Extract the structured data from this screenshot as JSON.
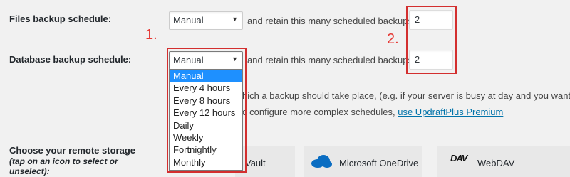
{
  "files_backup": {
    "label": "Files backup schedule:",
    "schedule_value": "Manual",
    "retain_text": "and retain this many scheduled backups:",
    "retain_value": "2"
  },
  "database_backup": {
    "label": "Database backup schedule:",
    "schedule_value": "Manual",
    "retain_text": "and retain this many scheduled backups:",
    "retain_value": "2"
  },
  "annotations": {
    "marker_1": "1.",
    "marker_2": "2."
  },
  "schedule_options": [
    "Manual",
    "Every 4 hours",
    "Every 8 hours",
    "Every 12 hours",
    "Daily",
    "Weekly",
    "Fortnightly",
    "Monthly"
  ],
  "schedule_note": {
    "line1": "hich a backup should take place, (e.g. if your server is busy at day and you want to",
    "line2": "c configure more complex schedules,",
    "link": "use UpdraftPlus Premium"
  },
  "remote_storage": {
    "label": "Choose your remote storage",
    "hint": "(tap on an icon to select or unselect):",
    "options": [
      "Vault",
      "Microsoft OneDrive",
      "WebDAV"
    ],
    "webdav_logo": "DAV"
  },
  "colors": {
    "annotation_red": "#d32f2f",
    "selected_option": "#1e90ff",
    "link": "#0073aa",
    "onedrive_blue": "#0a6dc2"
  }
}
